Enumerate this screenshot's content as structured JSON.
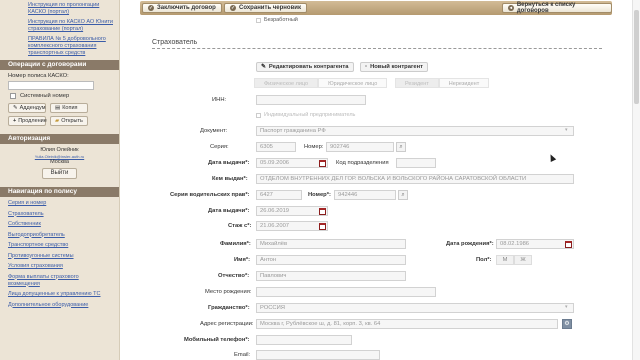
{
  "sidebar": {
    "top_links": [
      "Инструкция по пролонгации КАСКО (портал)",
      "Инструкция по КАСКО АО Юнити страхование (портал)",
      "ПРАВИЛА № 5 добровольного комплексного страхования транспортных средств"
    ],
    "ops": {
      "title": "Операции с договорами",
      "policy_label": "Номер полиса КАСКО:",
      "policy_value": "",
      "system_number_label": "Системный номер",
      "addendum_label": "Аддендум",
      "copy_label": "Копия",
      "extend_label": "Продление",
      "open_label": "Открыть"
    },
    "auth": {
      "title": "Авторизация",
      "user_name": "Юлия Олейник",
      "user_email": "Yulia.Oleinik@insler-auth.ru",
      "city": "Москва",
      "exit_label": "Выйти"
    },
    "nav": {
      "title": "Навигация по полису",
      "items": [
        "Серия и номер",
        "Страхователь",
        "Собственник",
        "Выгодоприобретатель",
        "Транспортное средство",
        "Противоугонные системы",
        "Условия страхования",
        "Форма выплаты страхового возмещения",
        "Лица допущенные к управлению ТС",
        "Дополнительное оборудование"
      ]
    }
  },
  "toolbar": {
    "conclude_label": "Заключить договор",
    "save_draft_label": "Сохранить черновик",
    "back_label": "Вернуться к списку договоров"
  },
  "form": {
    "unemployed_label": "Безработный",
    "section_title": "Страхователь",
    "edit_contractor_label": "Редактировать контрагента",
    "new_contractor_label": "Новый контрагент",
    "person_tabs": [
      "Физическое лицо",
      "Юридическое лицо"
    ],
    "residency_tabs": [
      "Резидент",
      "Нерезидент"
    ],
    "inn_label": "ИНН:",
    "inn_value": "",
    "entrepreneur_label": "Индивидуальный предприниматель",
    "document_label": "Документ:",
    "document_value": "Паспорт гражданина РФ",
    "series_label": "Серия:",
    "series_value": "6305",
    "number_label": "Номер:",
    "number_value": "902746",
    "issue_date_label": "Дата выдачи*:",
    "issue_date_value": "05.09.2006",
    "division_code_label": "Код подразделения",
    "division_code_value": "",
    "issued_by_label": "Кем выдан*:",
    "issued_by_value": "ОТДЕЛОМ ВНУТРЕННИХ ДЕЛ ГОР. ВОЛЬСКА И ВОЛЬСКОГО РАЙОНА САРАТОВСКОЙ ОБЛАСТИ",
    "license_series_label": "Серия водительских прав*:",
    "license_series_value": "6427",
    "license_number_label": "Номер*:",
    "license_number_value": "942446",
    "license_date_label": "Дата выдачи*:",
    "license_date_value": "26.06.2019",
    "experience_label": "Стаж с*:",
    "experience_value": "21.06.2007",
    "surname_label": "Фамилия*:",
    "surname_value": "Михайлёв",
    "birthdate_label": "Дата рождения*:",
    "birthdate_value": "08.02.1986",
    "name_label": "Имя*:",
    "name_value": "Антон",
    "gender_label": "Пол*:",
    "gender_options": [
      "М",
      "Ж"
    ],
    "patronymic_label": "Отчество*:",
    "patronymic_value": "Павлович",
    "birthplace_label": "Место рождения:",
    "birthplace_value": "",
    "citizenship_label": "Гражданство*:",
    "citizenship_value": "РОССИЯ",
    "address_label": "Адрес регистрации:",
    "address_value": "Москва г, Рублёвское ш, д. 81, корп. 3, кв. 64",
    "mobile_label": "Мобильный телефон*:",
    "mobile_value": "",
    "email_label": "Email:",
    "email_value": ""
  }
}
